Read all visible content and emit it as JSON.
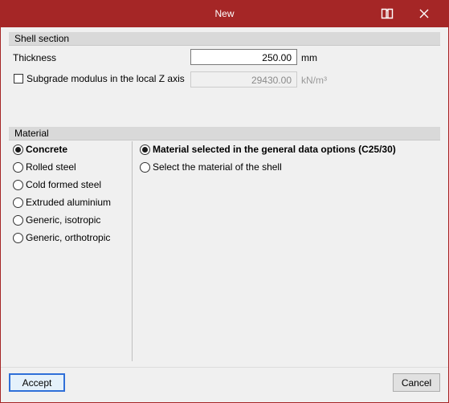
{
  "window": {
    "title": "New"
  },
  "shell_section": {
    "header": "Shell section",
    "thickness_label": "Thickness",
    "thickness_value": "250.00",
    "thickness_unit": "mm",
    "subgrade_label": "Subgrade modulus in the local Z axis",
    "subgrade_checked": false,
    "subgrade_value": "29430.00",
    "subgrade_unit": "kN/m³"
  },
  "material": {
    "header": "Material",
    "types": [
      {
        "label": "Concrete",
        "selected": true
      },
      {
        "label": "Rolled steel",
        "selected": false
      },
      {
        "label": "Cold formed steel",
        "selected": false
      },
      {
        "label": "Extruded aluminium",
        "selected": false
      },
      {
        "label": "Generic, isotropic",
        "selected": false
      },
      {
        "label": "Generic, orthotropic",
        "selected": false
      }
    ],
    "options": [
      {
        "label": "Material selected in the general data options (C25/30)",
        "selected": true
      },
      {
        "label": "Select the material of the shell",
        "selected": false
      }
    ]
  },
  "footer": {
    "accept_label": "Accept",
    "cancel_label": "Cancel"
  },
  "icons": {
    "help": "book-icon",
    "close": "close-icon"
  },
  "colors": {
    "titlebar": "#a52626",
    "focus": "#2f6fd8"
  }
}
